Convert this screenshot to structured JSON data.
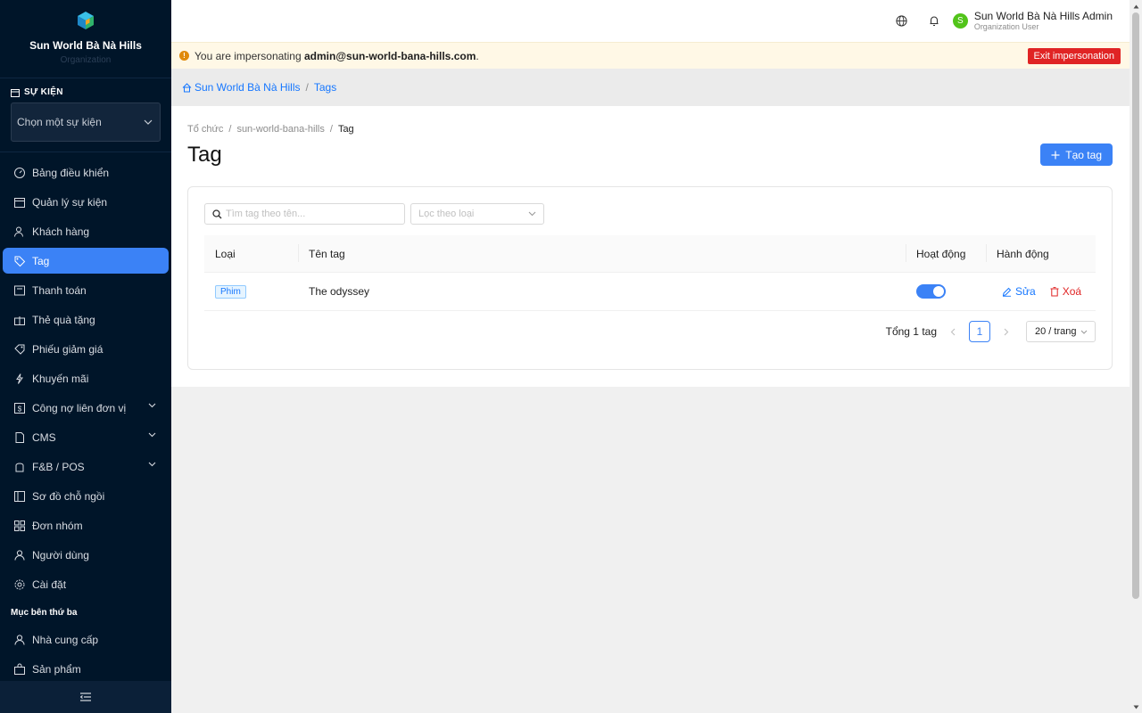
{
  "sidebar": {
    "brand_name": "Sun World Bà Nà Hills",
    "brand_sub": "Organization",
    "event_label": "SỰ KIỆN",
    "event_placeholder": "Chọn một sự kiện",
    "items": [
      {
        "label": "Bảng điều khiển",
        "icon": "dashboard-icon"
      },
      {
        "label": "Quản lý sự kiện",
        "icon": "calendar-icon"
      },
      {
        "label": "Khách hàng",
        "icon": "customers-icon"
      },
      {
        "label": "Tag",
        "icon": "tag-icon",
        "active": true
      },
      {
        "label": "Thanh toán",
        "icon": "payment-icon"
      },
      {
        "label": "Thẻ quà tặng",
        "icon": "gift-icon"
      },
      {
        "label": "Phiếu giảm giá",
        "icon": "coupon-icon"
      },
      {
        "label": "Khuyến mãi",
        "icon": "promotion-icon"
      },
      {
        "label": "Công nợ liên đơn vị",
        "icon": "debt-icon",
        "expandable": true
      },
      {
        "label": "CMS",
        "icon": "cms-icon",
        "expandable": true
      },
      {
        "label": "F&B / POS",
        "icon": "fnb-icon",
        "expandable": true
      },
      {
        "label": "Sơ đồ chỗ ngồi",
        "icon": "seatmap-icon"
      },
      {
        "label": "Đơn nhóm",
        "icon": "group-order-icon"
      },
      {
        "label": "Người dùng",
        "icon": "user-icon"
      },
      {
        "label": "Cài đặt",
        "icon": "settings-icon"
      }
    ],
    "third_party_label": "Mục bên thứ ba",
    "third_party_items": [
      {
        "label": "Nhà cung cấp",
        "icon": "supplier-icon"
      },
      {
        "label": "Sản phẩm",
        "icon": "product-icon"
      }
    ]
  },
  "topbar": {
    "user_name": "Sun World Bà Nà Hills Admin",
    "user_role": "Organization User",
    "avatar_letter": "S"
  },
  "impersonation": {
    "prefix": "You are impersonating",
    "email": "admin@sun-world-bana-hills.com",
    "suffix": ".",
    "exit_label": "Exit impersonation"
  },
  "breadcrumb_bar": {
    "home": "Sun World Bà Nà Hills",
    "current": "Tags"
  },
  "page": {
    "crumbs": [
      "Tổ chức",
      "sun-world-bana-hills",
      "Tag"
    ],
    "title": "Tag",
    "create_label": "Tạo tag"
  },
  "filters": {
    "search_placeholder": "Tìm tag theo tên...",
    "type_placeholder": "Lọc theo loại"
  },
  "table": {
    "headers": [
      "Loại",
      "Tên tag",
      "Hoạt động",
      "Hành động"
    ],
    "rows": [
      {
        "type": "Phim",
        "name": "The odyssey",
        "active": true,
        "edit": "Sửa",
        "delete": "Xoá"
      }
    ]
  },
  "pagination": {
    "total": "Tổng 1 tag",
    "current": "1",
    "page_size": "20 / trang"
  },
  "colors": {
    "sidebar_bg": "#001529",
    "accent": "#3b82f6",
    "danger": "#e02424"
  }
}
